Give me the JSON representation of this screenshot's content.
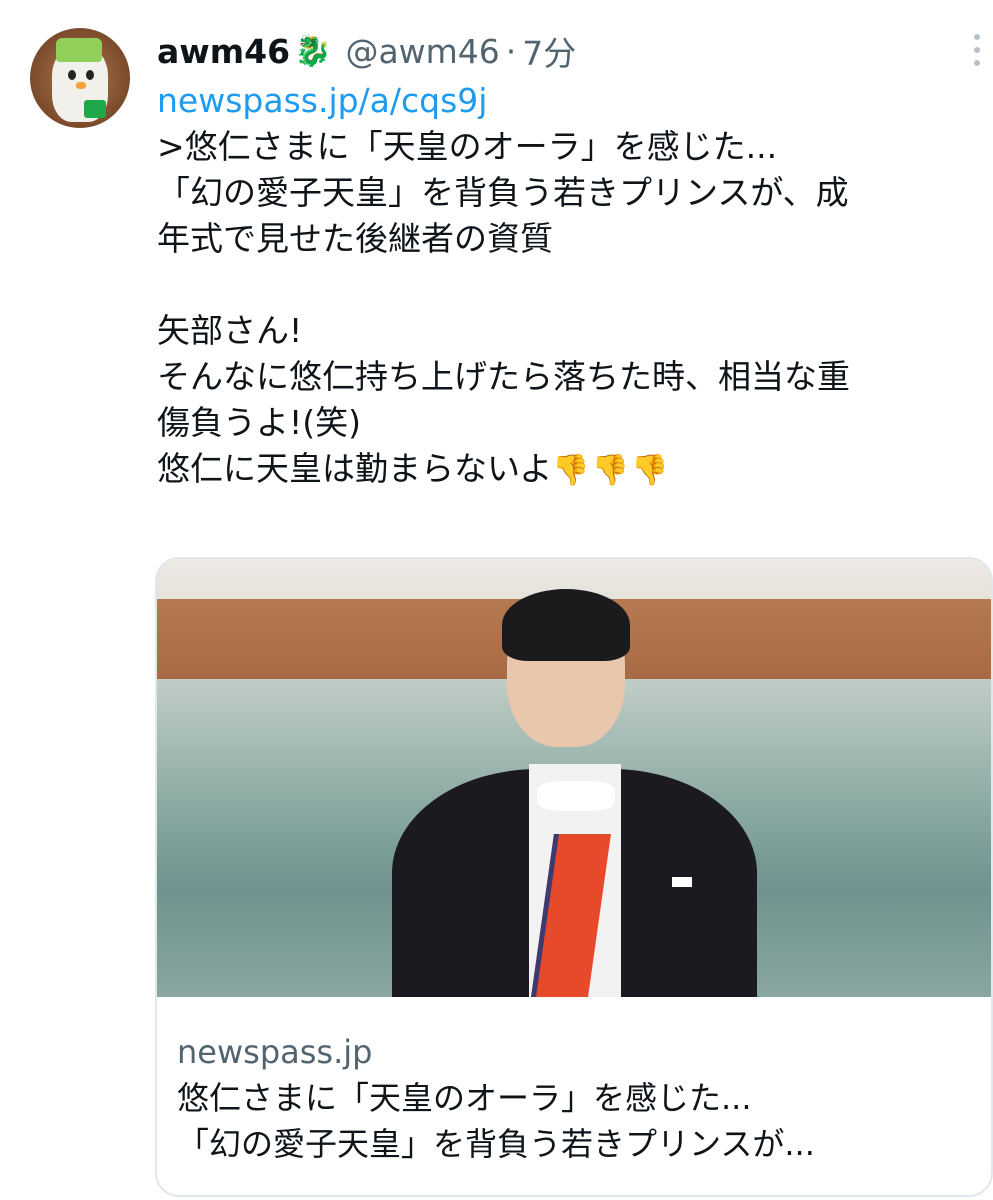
{
  "tweet": {
    "author": {
      "display_name": "awm46",
      "emoji": "🐉",
      "handle": "@awm46",
      "separator": "·",
      "time": "7分"
    },
    "text_lines": [
      "newspass.jp/a/cqs9j",
      ">悠仁さまに「天皇のオーラ」を感じた...",
      "「幻の愛子天皇」を背負う若きプリンスが、成",
      "年式で見せた後継者の資質",
      "",
      "矢部さん!",
      "そんなに悠仁持ち上げたら落ちた時、相当な重",
      "傷負うよ!(笑)",
      "悠仁に天皇は勤まらないよ"
    ],
    "thumbs_emoji": "👎👎👎",
    "more_icon": "more-vertical-icon",
    "link_color": "#1d9bf0"
  },
  "card": {
    "domain": "newspass.jp",
    "title_lines": [
      "悠仁さまに「天皇のオーラ」を感じた...",
      "「幻の愛子天皇」を背負う若きプリンスが..."
    ]
  }
}
